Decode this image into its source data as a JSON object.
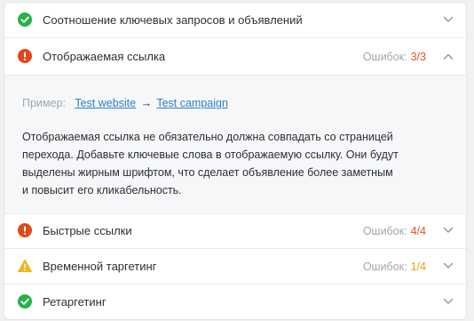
{
  "rows": [
    {
      "title": "Соотношение ключевых запросов и объявлений",
      "status": "ok"
    },
    {
      "title": "Отображаемая ссылка",
      "status": "error",
      "errors_label": "Ошибок:",
      "errors_count": "3/3"
    },
    {
      "title": "Быстрые ссылки",
      "status": "error",
      "errors_label": "Ошибок:",
      "errors_count": "4/4"
    },
    {
      "title": "Временной таргетинг",
      "status": "warning",
      "errors_label": "Ошибок:",
      "errors_count": "1/4"
    },
    {
      "title": "Ретаргетинг",
      "status": "ok"
    }
  ],
  "expanded": {
    "example_label": "Пример:",
    "link_website": "Test website",
    "arrow": "→",
    "link_campaign": "Test campaign",
    "description_lines": [
      "Отображаемая ссылка не обязательно должна совпадать со страницей",
      "перехода. Добавьте ключевые слова в отображаемую ссылку. Они будут",
      "выделены жирным шрифтом, что сделает объявление более заметным",
      "и повысит его кликабельность."
    ]
  },
  "colors": {
    "ok": "#27b14a",
    "error": "#e0481a",
    "warning": "#f4b41a",
    "link": "#2a7ec8"
  },
  "icons": {
    "ok": "check-circle-icon",
    "error": "exclamation-circle-icon",
    "warning": "warning-triangle-icon",
    "collapsed": "chevron-down-icon",
    "expanded": "chevron-up-icon"
  }
}
